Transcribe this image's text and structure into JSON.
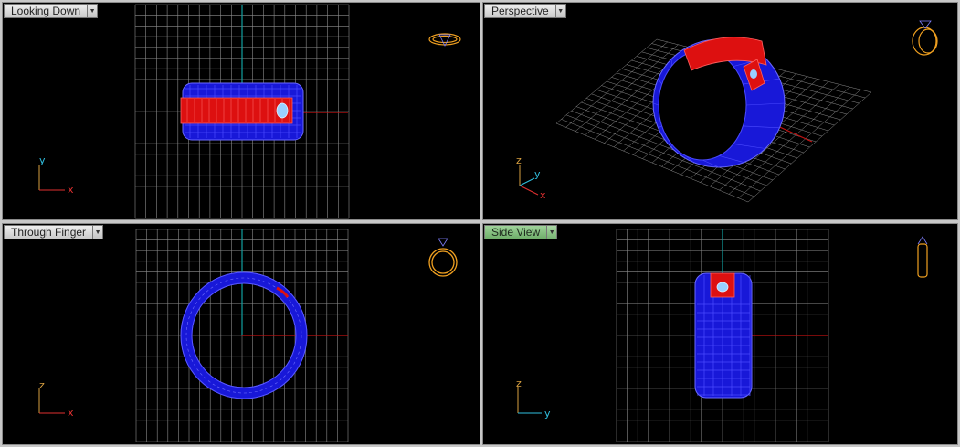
{
  "viewports": [
    {
      "id": "tl",
      "title": "Looking Down",
      "active": false,
      "axis_labels": [
        "y",
        "x"
      ]
    },
    {
      "id": "tr",
      "title": "Perspective",
      "active": false,
      "axis_labels": [
        "z",
        "y",
        "x"
      ]
    },
    {
      "id": "bl",
      "title": "Through Finger",
      "active": false,
      "axis_labels": [
        "z",
        "x"
      ]
    },
    {
      "id": "br",
      "title": "Side View",
      "active": true,
      "axis_labels": [
        "z",
        "y"
      ]
    }
  ],
  "colors": {
    "background": "#000000",
    "grid": "#8c8c8c",
    "x_axis": "#c01010",
    "y_axis": "#10a0a0",
    "ring_blue": "#1818d8",
    "ring_red": "#dd1010",
    "axis_icon_yellow": "#d8a040",
    "axis_icon_red": "#e03030",
    "axis_icon_cyan": "#30c0e0",
    "preview_orange": "#f0a020"
  },
  "icons": {
    "viewport_menu": "chevron-down-icon",
    "ring_preview": "ring-preview-icon",
    "axis_triad": "axis-triad-icon"
  }
}
